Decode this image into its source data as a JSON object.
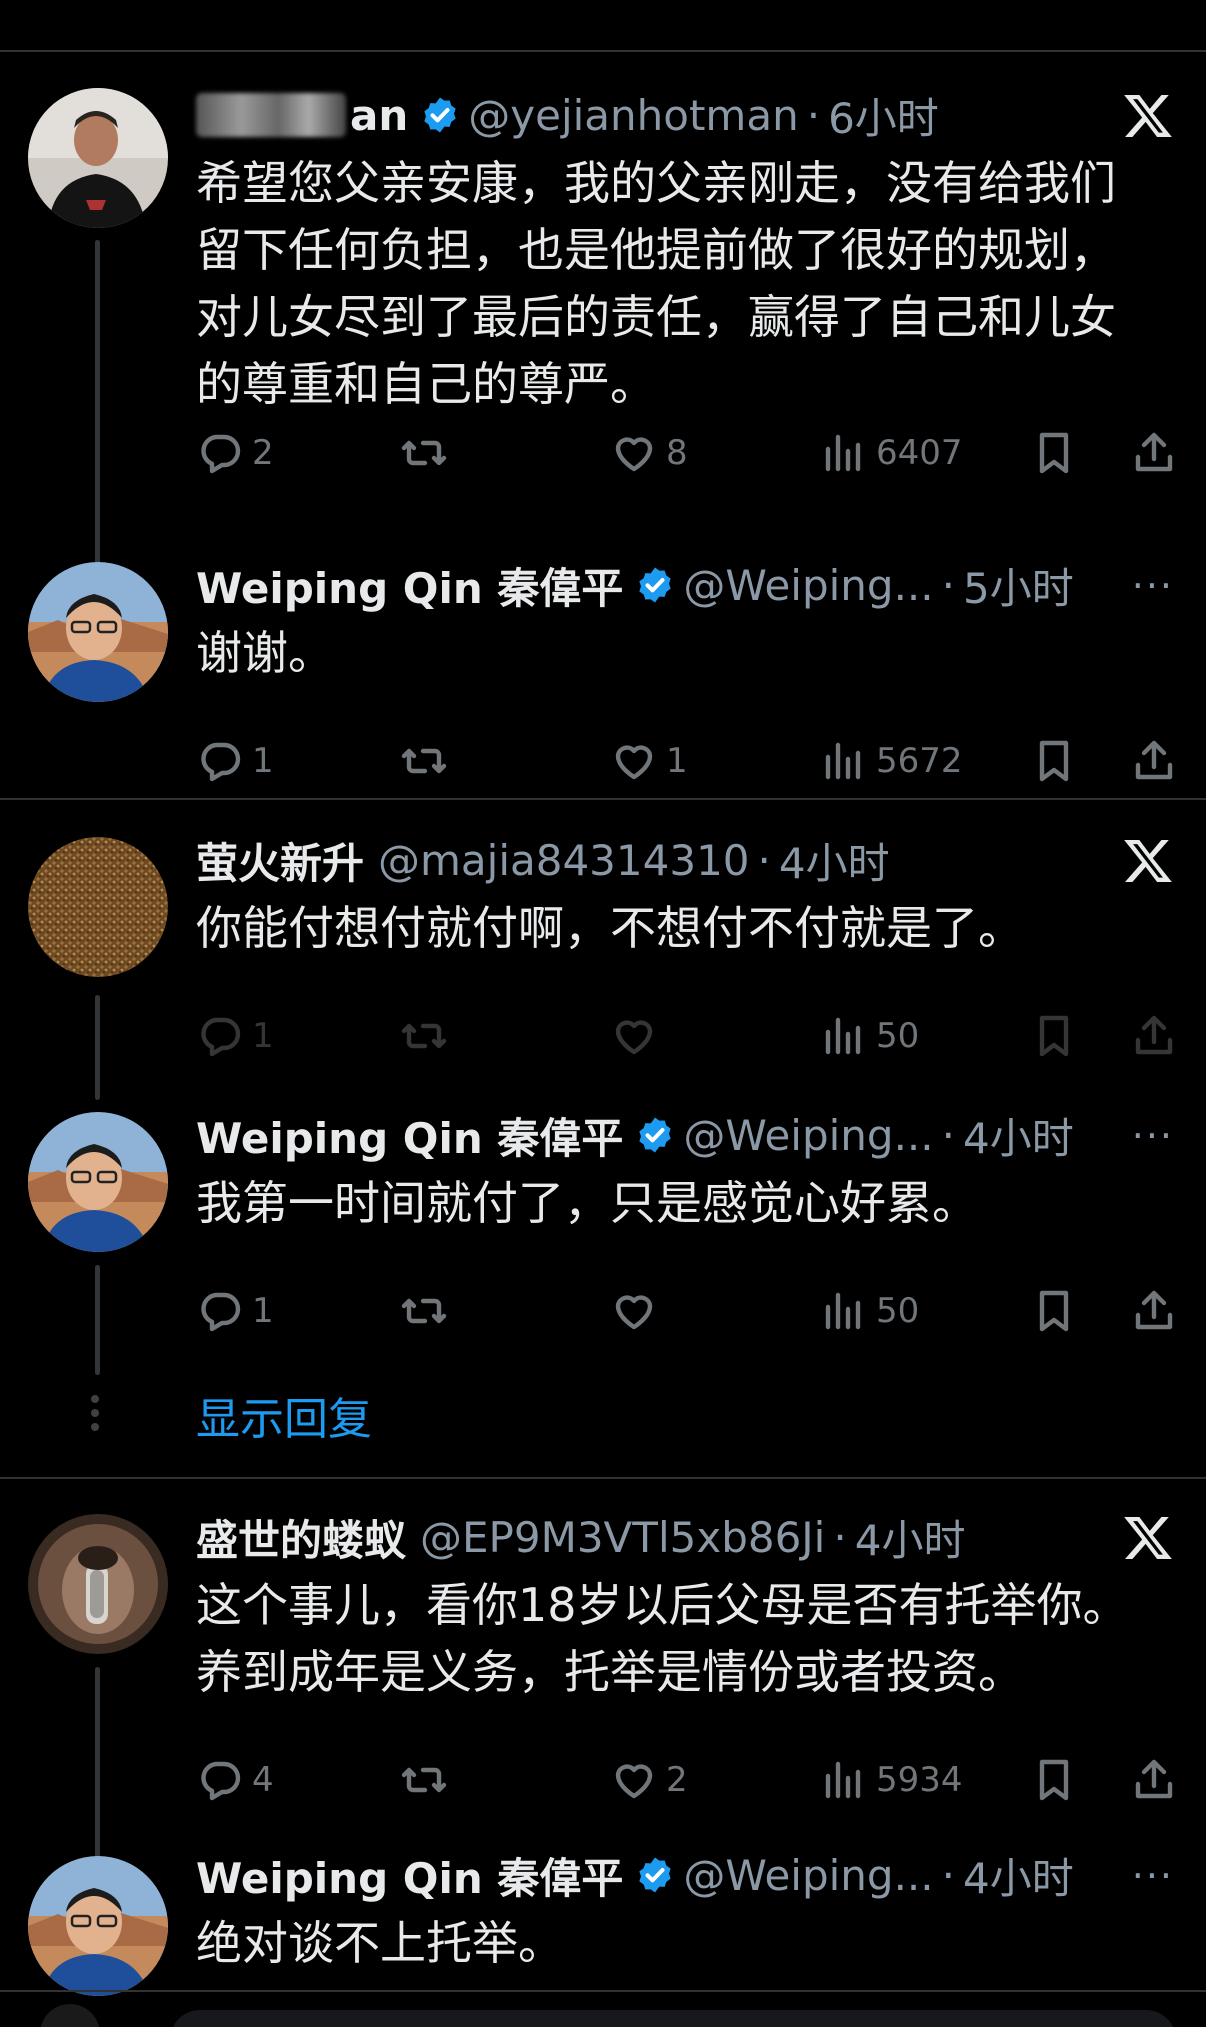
{
  "colors": {
    "background": "#000000",
    "text": "#e7e9ea",
    "muted": "#71767b",
    "accent": "#1d9bf0",
    "divider": "#2f3336"
  },
  "posts": [
    {
      "name": "an",
      "handle": "@yejianhotman",
      "dot": "·",
      "time": "6小时",
      "text_lines": [
        "希望您父亲安康，我的父亲刚走，没有给我们",
        "留下任何负担，也是他提前做了很好的规划，",
        "对儿女尽到了最后的责任，赢得了自己和儿女",
        "的尊重和自己的尊严。"
      ],
      "replies": "2",
      "retweets": "",
      "likes": "8",
      "views": "6407",
      "corner_icon": "x-logo"
    },
    {
      "name": "Weiping Qin 秦偉平",
      "handle": "@Weiping...",
      "dot": "·",
      "time": "5小时",
      "text_lines": [
        "谢谢。"
      ],
      "replies": "1",
      "retweets": "",
      "likes": "1",
      "views": "5672",
      "corner_icon": "more-icon"
    },
    {
      "name": "萤火新升",
      "handle": "@majia84314310",
      "dot": "·",
      "time": "4小时",
      "text_lines": [
        "你能付想付就付啊，不想付不付就是了。"
      ],
      "replies": "1",
      "retweets": "",
      "likes": "",
      "views": "50",
      "corner_icon": "x-logo"
    },
    {
      "name": "Weiping Qin 秦偉平",
      "handle": "@Weiping...",
      "dot": "·",
      "time": "4小时",
      "text_lines": [
        "我第一时间就付了，只是感觉心好累。"
      ],
      "replies": "1",
      "retweets": "",
      "likes": "",
      "views": "50",
      "corner_icon": "more-icon"
    },
    {
      "name": "盛世的蝼蚁",
      "handle": "@EP9M3VTl5xb86Ji",
      "dot": "·",
      "time": "4小时",
      "text_lines": [
        "这个事儿，看你18岁以后父母是否有托举你。",
        "养到成年是义务，托举是情份或者投资。"
      ],
      "replies": "4",
      "retweets": "",
      "likes": "2",
      "views": "5934",
      "corner_icon": "x-logo"
    },
    {
      "name": "Weiping Qin 秦偉平",
      "handle": "@Weiping...",
      "dot": "·",
      "time": "4小时",
      "text_lines": [
        "绝对谈不上托举。"
      ],
      "corner_icon": "more-icon"
    }
  ],
  "more_icon_text": "···",
  "show_replies": "显示回复"
}
